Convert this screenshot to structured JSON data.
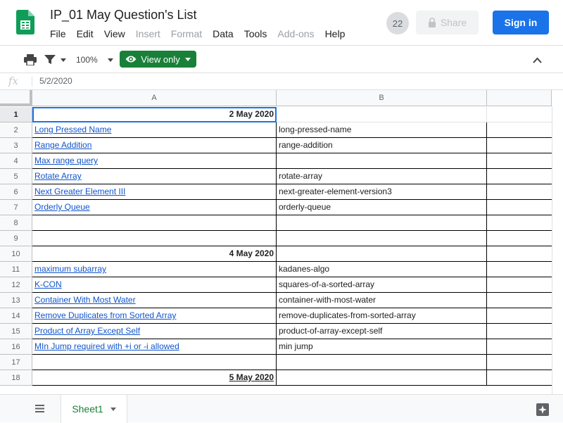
{
  "document": {
    "title": "IP_01 May Question's List"
  },
  "menu": [
    {
      "label": "File",
      "disabled": false
    },
    {
      "label": "Edit",
      "disabled": false
    },
    {
      "label": "View",
      "disabled": false
    },
    {
      "label": "Insert",
      "disabled": true
    },
    {
      "label": "Format",
      "disabled": true
    },
    {
      "label": "Data",
      "disabled": false
    },
    {
      "label": "Tools",
      "disabled": false
    },
    {
      "label": "Add-ons",
      "disabled": true
    },
    {
      "label": "Help",
      "disabled": false
    }
  ],
  "header": {
    "viewer_count": "22",
    "share_label": "Share",
    "signin_label": "Sign in"
  },
  "toolbar": {
    "zoom": "100%",
    "view_mode": "View only"
  },
  "formula_bar": {
    "fx": "fx",
    "value": "5/2/2020"
  },
  "columns": [
    "A",
    "B"
  ],
  "rows": [
    {
      "num": "1",
      "a": "2 May 2020",
      "a_kind": "date",
      "b": ""
    },
    {
      "num": "2",
      "a": "Long Pressed Name",
      "a_kind": "link",
      "b": "long-pressed-name"
    },
    {
      "num": "3",
      "a": "Range Addition",
      "a_kind": "link",
      "b": "range-addition"
    },
    {
      "num": "4",
      "a": "Max range query",
      "a_kind": "link",
      "b": ""
    },
    {
      "num": "5",
      "a": "Rotate Array",
      "a_kind": "link",
      "b": "rotate-array"
    },
    {
      "num": "6",
      "a": "Next Greater Element III",
      "a_kind": "link",
      "b": "next-greater-element-version3"
    },
    {
      "num": "7",
      "a": "Orderly Queue",
      "a_kind": "link",
      "b": "orderly-queue"
    },
    {
      "num": "8",
      "a": "",
      "a_kind": "text",
      "b": ""
    },
    {
      "num": "9",
      "a": "",
      "a_kind": "text",
      "b": ""
    },
    {
      "num": "10",
      "a": "4 May 2020",
      "a_kind": "date",
      "b": ""
    },
    {
      "num": "11",
      "a": "maximum subarray",
      "a_kind": "link",
      "b": "kadanes-algo"
    },
    {
      "num": "12",
      "a": "K-CON",
      "a_kind": "link",
      "b": "squares-of-a-sorted-array"
    },
    {
      "num": "13",
      "a": "Container With Most Water",
      "a_kind": "link",
      "b": "container-with-most-water"
    },
    {
      "num": "14",
      "a": "Remove Duplicates from Sorted Array",
      "a_kind": "link",
      "b": "remove-duplicates-from-sorted-array"
    },
    {
      "num": "15",
      "a": "Product of Array Except Self",
      "a_kind": "link",
      "b": "product-of-array-except-self"
    },
    {
      "num": "16",
      "a": "MIn Jump required with +i or -i allowed",
      "a_kind": "link",
      "b": "min jump"
    },
    {
      "num": "17",
      "a": "",
      "a_kind": "text",
      "b": ""
    },
    {
      "num": "18",
      "a": "5 May 2020",
      "a_kind": "date-underline",
      "b": ""
    }
  ],
  "sheet": {
    "name": "Sheet1"
  },
  "colors": {
    "accent_blue": "#1a73e8",
    "view_only_green": "#188038",
    "link_blue": "#1155cc",
    "logo_green": "#0f9d58"
  }
}
